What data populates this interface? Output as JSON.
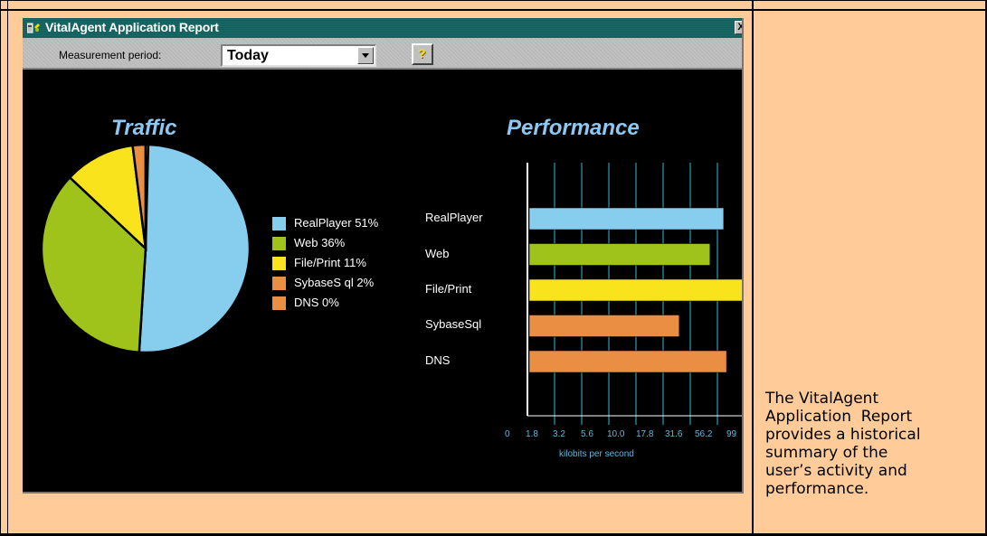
{
  "window": {
    "title": "VitalAgent Application Report",
    "close_label": "X"
  },
  "toolbar": {
    "period_label": "Measurement period:",
    "period_value": "Today",
    "help_label": "?"
  },
  "traffic": {
    "title": "Traffic",
    "legend": [
      {
        "label": "RealPlayer 51%",
        "color": "#87cdee"
      },
      {
        "label": "Web 36%",
        "color": "#9fc31a"
      },
      {
        "label": "File/Print 11%",
        "color": "#f8e31c"
      },
      {
        "label": "SybaseS ql 2%",
        "color": "#ea8e44"
      },
      {
        "label": "DNS 0%",
        "color": "#ea8e44"
      }
    ]
  },
  "performance": {
    "title": "Performance",
    "xlabel": "kilobits per second",
    "ticks": [
      "0",
      "1.8",
      "3.2",
      "5.6",
      "10.0",
      "17.8",
      "31.6",
      "56.2",
      "99"
    ]
  },
  "caption": "The VitalAgent\nApplication  Report\nprovides a historical\nsummary of the\nuser’s activity and\nperformance.",
  "chart_data": [
    {
      "type": "pie",
      "title": "Traffic",
      "categories": [
        "RealPlayer",
        "Web",
        "File/Print",
        "SybaseSql",
        "DNS"
      ],
      "values": [
        51,
        36,
        11,
        2,
        0
      ],
      "colors": [
        "#87cdee",
        "#9fc31a",
        "#f8e31c",
        "#ea8e44",
        "#ea8e44"
      ],
      "legend": "right"
    },
    {
      "type": "bar",
      "orientation": "horizontal",
      "title": "Performance",
      "categories": [
        "RealPlayer",
        "Web",
        "File/Print",
        "SybaseSql",
        "DNS"
      ],
      "values": [
        64,
        48,
        105,
        25,
        68
      ],
      "colors": [
        "#87cdee",
        "#9fc31a",
        "#f8e31c",
        "#ea8e44",
        "#ea8e44"
      ],
      "xlabel": "kilobits per second",
      "xscale": "log",
      "xticks": [
        "0",
        "1.8",
        "3.2",
        "5.6",
        "10.0",
        "17.8",
        "31.6",
        "56.2",
        "99"
      ],
      "grid": true
    }
  ]
}
